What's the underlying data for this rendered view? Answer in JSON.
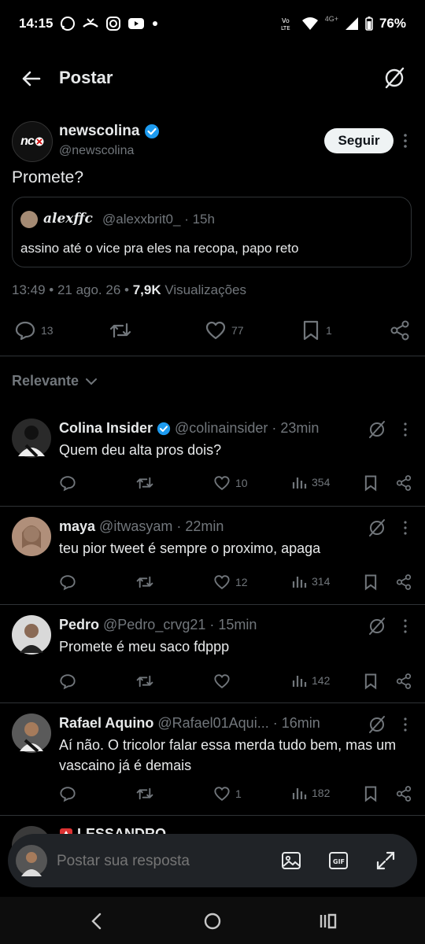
{
  "status_bar": {
    "time": "14:15",
    "battery": "76%",
    "network": "4G+"
  },
  "header": {
    "title": "Postar"
  },
  "post": {
    "author_name": "newscolina",
    "author_handle": "@newscolina",
    "avatar_text": "nc",
    "follow_label": "Seguir",
    "text": "Promete?",
    "quote": {
      "author_name": "alexffc",
      "author_handle": "@alexxbrit0_ · 15h",
      "text": "assino até o vice pra eles na recopa, papo reto"
    },
    "time": "13:49 • 21 ago. 26 •",
    "views_count": "7,9K",
    "views_label": "Visualizações",
    "stats": {
      "replies": "13",
      "likes": "77",
      "bookmarks": "1"
    }
  },
  "sort": {
    "label": "Relevante"
  },
  "replies": [
    {
      "name": "Colina Insider",
      "verified": true,
      "handle": "@colinainsider · 23min",
      "text": "Quem deu alta pros dois?",
      "likes": "10",
      "views": "354",
      "avatar_color": "#2a2a2a"
    },
    {
      "name": "maya",
      "verified": false,
      "handle": "@itwasyam · 22min",
      "text": "teu pior tweet é sempre o proximo, apaga",
      "likes": "12",
      "views": "314",
      "avatar_color": "#b08f7a"
    },
    {
      "name": "Pedro",
      "verified": false,
      "handle": "@Pedro_crvg21 · 15min",
      "text": "Promete é meu saco fdppp",
      "likes": "",
      "views": "142",
      "avatar_color": "#d9d9d9"
    },
    {
      "name": "Rafael Aquino",
      "verified": false,
      "handle": "@Rafael01Aqui... · 16min",
      "text": "Aí não. O tricolor falar essa merda tudo bem, mas um vascaino já é demais",
      "likes": "1",
      "views": "182",
      "avatar_color": "#5a5a5a"
    },
    {
      "name": "LESSANDRO",
      "verified": false,
      "handle": "",
      "text": "",
      "likes": "",
      "views": "",
      "avatar_color": "#3a3a3a"
    }
  ],
  "composer": {
    "placeholder": "Postar sua resposta"
  },
  "colors": {
    "background": "#000000",
    "text": "#e7e9ea",
    "muted": "#71767b",
    "verified": "#1d9bf0",
    "divider": "#2f3336"
  }
}
